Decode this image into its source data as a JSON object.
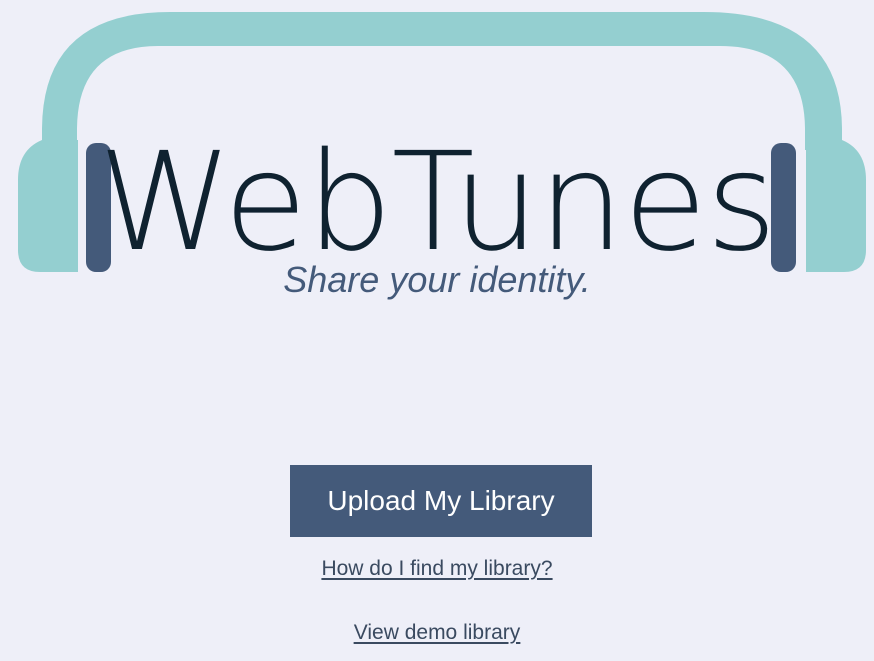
{
  "brand": {
    "title": "WebTunes",
    "tagline": "Share your identity."
  },
  "actions": {
    "upload_label": "Upload My Library",
    "help_link": "How do I find my library?",
    "demo_link": "View demo library"
  },
  "colors": {
    "background": "#eeeff8",
    "headband": "#94cfd0",
    "earpiece_inner": "#445a7a",
    "title_text": "#0f2230",
    "accent": "#445a7a"
  },
  "icons": {
    "logo": "headphones-icon"
  }
}
